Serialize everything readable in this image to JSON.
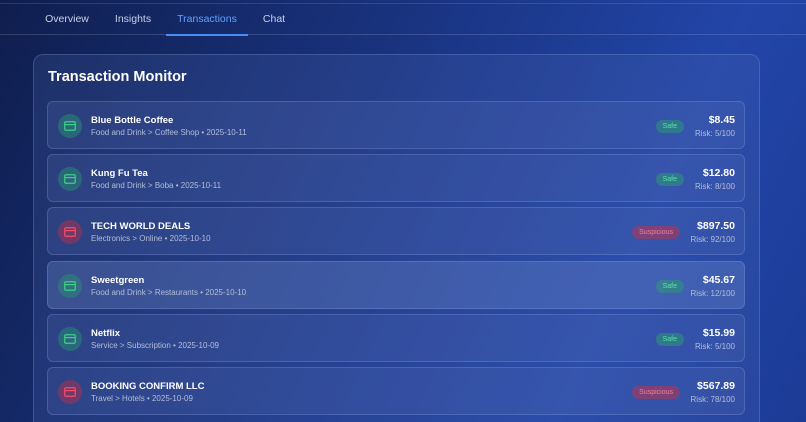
{
  "nav": {
    "tabs": [
      {
        "label": "Overview",
        "active": false
      },
      {
        "label": "Insights",
        "active": false
      },
      {
        "label": "Transactions",
        "active": true
      },
      {
        "label": "Chat",
        "active": false
      }
    ]
  },
  "monitor": {
    "title": "Transaction Monitor",
    "transactions": [
      {
        "merchant": "Blue Bottle Coffee",
        "meta": "Food and Drink > Coffee Shop • 2025-10-11",
        "status": "Safe",
        "amount": "$8.45",
        "risk": "Risk: 5/100",
        "icon": "credit-card-icon"
      },
      {
        "merchant": "Kung Fu Tea",
        "meta": "Food and Drink > Boba • 2025-10-11",
        "status": "Safe",
        "amount": "$12.80",
        "risk": "Risk: 8/100",
        "icon": "credit-card-icon"
      },
      {
        "merchant": "TECH WORLD DEALS",
        "meta": "Electronics > Online • 2025-10-10",
        "status": "Suspicious",
        "amount": "$897.50",
        "risk": "Risk: 92/100",
        "icon": "credit-card-icon"
      },
      {
        "merchant": "Sweetgreen",
        "meta": "Food and Drink > Restaurants • 2025-10-10",
        "status": "Safe",
        "amount": "$45.67",
        "risk": "Risk: 12/100",
        "icon": "credit-card-icon"
      },
      {
        "merchant": "Netflix",
        "meta": "Service > Subscription • 2025-10-09",
        "status": "Safe",
        "amount": "$15.99",
        "risk": "Risk: 5/100",
        "icon": "credit-card-icon"
      },
      {
        "merchant": "BOOKING CONFIRM LLC",
        "meta": "Travel > Hotels • 2025-10-09",
        "status": "Suspicious",
        "amount": "$567.89",
        "risk": "Risk: 78/100",
        "icon": "credit-card-icon"
      }
    ]
  },
  "colors": {
    "accent": "#4a8cf5",
    "safe": "#5fe0a4",
    "suspicious": "#f08098"
  }
}
